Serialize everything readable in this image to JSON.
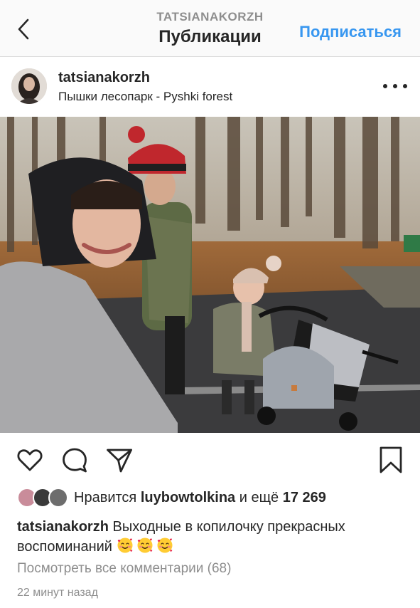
{
  "nav": {
    "account_name": "TATSIANAKORZH",
    "title": "Публикации",
    "follow_label": "Подписаться"
  },
  "post": {
    "username": "tatsianakorzh",
    "location": "Пышки лесопарк - Pyshki forest"
  },
  "likes": {
    "prefix": "Нравится",
    "liker": "luybowtolkina",
    "connector": "и ещё",
    "count": "17 269"
  },
  "caption": {
    "username": "tatsianakorzh",
    "text": "Выходные в копилочку прекрасных воспоминаний",
    "emoji": [
      "smiling-face-with-hearts",
      "smiling-face-with-hearts",
      "smiling-face-with-hearts"
    ]
  },
  "comments": {
    "label": "Посмотреть все комментарии (68)"
  },
  "timestamp": "22 минут назад",
  "colors": {
    "accent": "#3897f0",
    "text": "#262626",
    "muted": "#8e8e8e",
    "nav_bg": "#fafafa"
  }
}
